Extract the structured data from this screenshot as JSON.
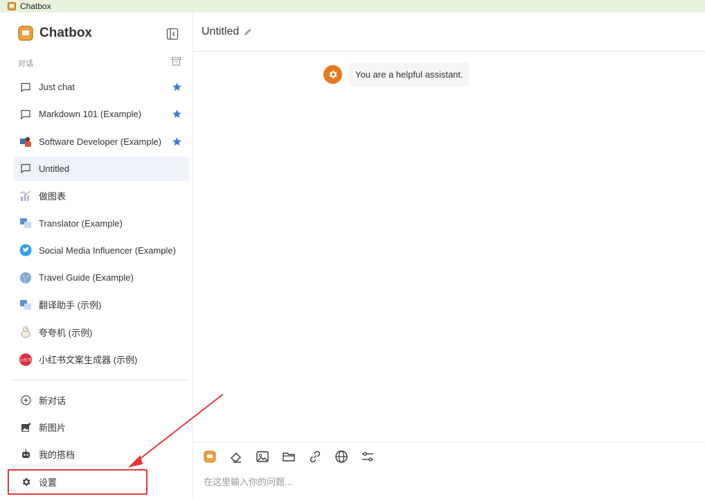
{
  "window": {
    "title": "Chatbox"
  },
  "sidebar": {
    "brand": "Chatbox",
    "section_label": "对话",
    "sessions": [
      {
        "label": "Just chat",
        "icon": "chat-bubble-icon",
        "starred": true
      },
      {
        "label": "Markdown 101 (Example)",
        "icon": "chat-bubble-icon",
        "starred": true
      },
      {
        "label": "Software Developer (Example)",
        "icon": "developer-avatar-icon",
        "starred": true
      },
      {
        "label": "Untitled",
        "icon": "chat-bubble-icon",
        "starred": false,
        "active": true
      },
      {
        "label": "做图表",
        "icon": "chart-avatar-icon",
        "starred": false
      },
      {
        "label": "Translator (Example)",
        "icon": "translator-avatar-icon",
        "starred": false
      },
      {
        "label": "Social Media Influencer (Example)",
        "icon": "twitter-avatar-icon",
        "starred": false
      },
      {
        "label": "Travel Guide (Example)",
        "icon": "globe-avatar-icon",
        "starred": false
      },
      {
        "label": "翻译助手 (示例)",
        "icon": "translator-avatar-icon",
        "starred": false
      },
      {
        "label": "夸夸机 (示例)",
        "icon": "duck-avatar-icon",
        "starred": false
      },
      {
        "label": "小红书文案生成器 (示例)",
        "icon": "xiaohongshu-avatar-icon",
        "starred": false
      }
    ],
    "footer": {
      "new_chat": "新对话",
      "new_image": "新图片",
      "my_copilots": "我的搭档",
      "settings": "设置"
    },
    "xhs_badge": "小红书"
  },
  "main": {
    "title": "Untitled",
    "system_message": "You are a helpful assistant.",
    "input_placeholder": "在这里输入你的问题..."
  },
  "colors": {
    "accent_star": "#3c7fd0",
    "system_avatar": "#e8781e",
    "annotation_red": "#e8353a",
    "titlebar_bg": "#e7f2dc"
  }
}
